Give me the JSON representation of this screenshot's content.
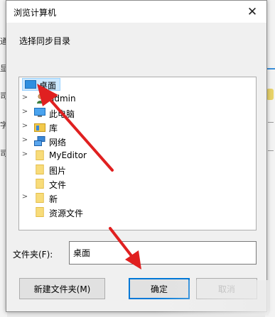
{
  "background": {
    "left_chars": [
      "通",
      "显",
      "司",
      "字",
      "司"
    ]
  },
  "dialog": {
    "title": "浏览计算机",
    "close_symbol": "✕",
    "instruction": "选择同步目录",
    "tree": [
      {
        "label": "桌面",
        "icon": "desktop-icon",
        "selected": true
      },
      {
        "label": "admin",
        "icon": "user-icon",
        "expandable": true
      },
      {
        "label": "此电脑",
        "icon": "computer-icon",
        "expandable": true
      },
      {
        "label": "库",
        "icon": "library-icon",
        "expandable": true
      },
      {
        "label": "网络",
        "icon": "network-icon",
        "expandable": true
      },
      {
        "label": "MyEditor",
        "icon": "folder-icon",
        "expandable": true
      },
      {
        "label": "图片",
        "icon": "folder-icon"
      },
      {
        "label": "文件",
        "icon": "folder-icon"
      },
      {
        "label": "新",
        "icon": "folder-icon",
        "expandable": true
      },
      {
        "label": "资源文件",
        "icon": "folder-icon"
      }
    ],
    "folder_field": {
      "label": "文件夹(F):",
      "value": "桌面"
    },
    "buttons": {
      "new_folder": "新建文件夹(M)",
      "ok": "确定",
      "cancel": "取消"
    },
    "accent_color": "#0078d7",
    "arrow_color": "#e02020"
  }
}
